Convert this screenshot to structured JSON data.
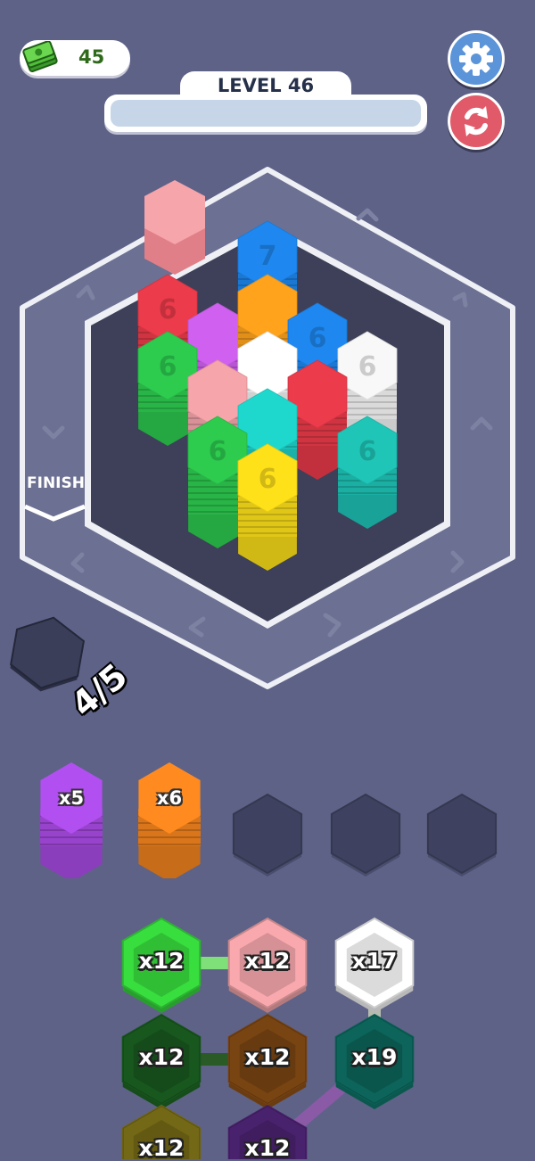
{
  "header": {
    "cash": "45",
    "level": "LEVEL 46",
    "level_progress": 0.0
  },
  "buttons": {
    "settings_icon": "gear-icon",
    "restart_icon": "restart-icon"
  },
  "board": {
    "finish_label": "FINISH",
    "waiting_stack_color": "#f29aa0",
    "cells": [
      {
        "id": "top-blue",
        "color": "#1e88f0",
        "count": "7"
      },
      {
        "id": "red-left",
        "color": "#ec3b4a",
        "count": "6"
      },
      {
        "id": "purple",
        "color": "#d061f0",
        "count": ""
      },
      {
        "id": "orange",
        "color": "#ffa21c",
        "count": ""
      },
      {
        "id": "blue-right",
        "color": "#1e88f0",
        "count": "6"
      },
      {
        "id": "green-left",
        "color": "#2dcc4f",
        "count": "6"
      },
      {
        "id": "white-center",
        "color": "#ffffff",
        "count": ""
      },
      {
        "id": "white-right",
        "color": "#f8f8f8",
        "count": "6"
      },
      {
        "id": "pink",
        "color": "#f6a5ab",
        "count": ""
      },
      {
        "id": "red-center",
        "color": "#ec3b4a",
        "count": ""
      },
      {
        "id": "cyan-center",
        "color": "#1fd8cd",
        "count": ""
      },
      {
        "id": "green-low",
        "color": "#2dcc4f",
        "count": "6"
      },
      {
        "id": "yellow",
        "color": "#ffe11a",
        "count": "6"
      },
      {
        "id": "teal-right",
        "color": "#1fc6b8",
        "count": "6"
      }
    ]
  },
  "counter": {
    "text": "4/5"
  },
  "tray": [
    {
      "label": "x5",
      "color": "#b24ff0",
      "filled": true
    },
    {
      "label": "x6",
      "color": "#ff8a1f",
      "filled": true
    },
    {
      "label": "",
      "color": "#3e4260",
      "filled": false
    },
    {
      "label": "",
      "color": "#3e4260",
      "filled": false
    },
    {
      "label": "",
      "color": "#3e4260",
      "filled": false
    }
  ],
  "bins": [
    {
      "label": "x12",
      "color": "#38dd3e",
      "locked": false
    },
    {
      "label": "x12",
      "color": "#f9a9ae",
      "locked": false
    },
    {
      "label": "x17",
      "color": "#ffffff",
      "locked": false
    },
    {
      "label": "x12",
      "color": "#1e6b25",
      "locked": true
    },
    {
      "label": "x12",
      "color": "#935316",
      "locked": true
    },
    {
      "label": "x19",
      "color": "#0f7a6e",
      "locked": true
    },
    {
      "label": "x12",
      "color": "#8d7f1a",
      "locked": true
    },
    {
      "label": "x12",
      "color": "#5a2a86",
      "locked": true
    }
  ]
}
